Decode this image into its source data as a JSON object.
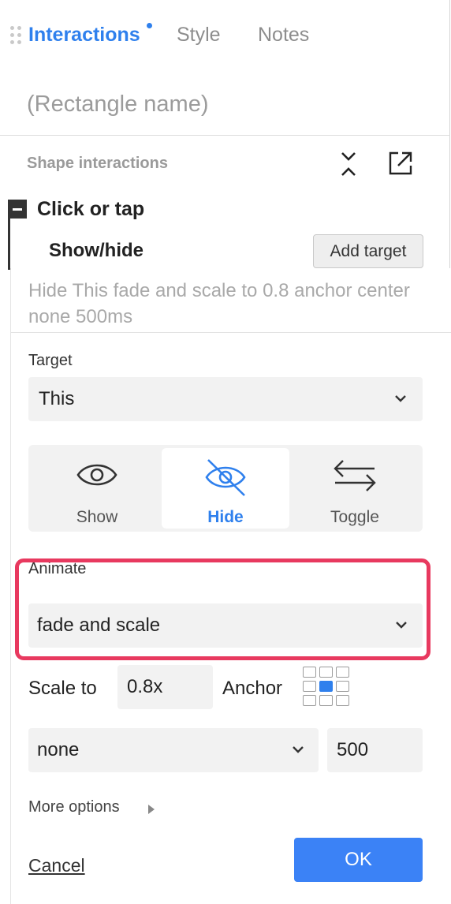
{
  "tabs": {
    "interactions": "Interactions",
    "style": "Style",
    "notes": "Notes"
  },
  "shape": {
    "name_placeholder": "(Rectangle name)"
  },
  "section": {
    "title": "Shape interactions",
    "collapse_icon": "collapse-icon",
    "external_icon": "external-link-icon"
  },
  "interaction": {
    "trigger": "Click or tap",
    "action": "Show/hide",
    "add_target": "Add target"
  },
  "editor": {
    "summary": "Hide This fade and scale to 0.8 anchor center none 500ms",
    "target_label": "Target",
    "target_value": "This",
    "modes": [
      {
        "label": "Show",
        "icon": "eye-icon"
      },
      {
        "label": "Hide",
        "icon": "eye-off-icon"
      },
      {
        "label": "Toggle",
        "icon": "swap-arrows-icon"
      }
    ],
    "selected_mode": "Hide",
    "animate_label": "Animate",
    "animate_value": "fade and scale",
    "scale_label": "Scale to",
    "scale_value": "0.8x",
    "anchor_label": "Anchor",
    "anchor_selected": "center",
    "easing_value": "none",
    "duration_value": "500",
    "more_options": "More options",
    "cancel": "Cancel",
    "ok": "OK"
  },
  "colors": {
    "accent": "#2f80ed",
    "highlight": "#e8395f",
    "ok_button": "#3b82f6"
  }
}
